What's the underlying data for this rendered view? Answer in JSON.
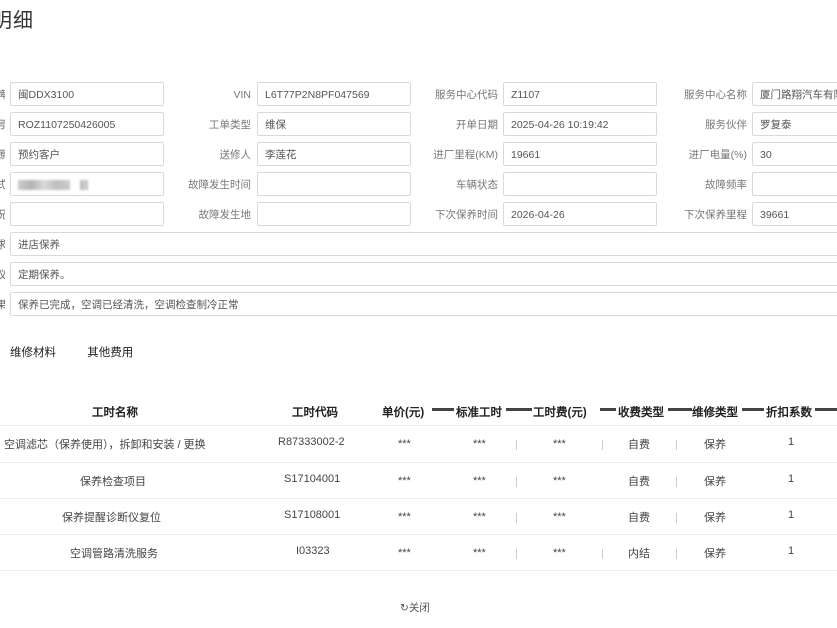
{
  "page": {
    "title": "明细"
  },
  "form": {
    "rows": [
      {
        "cut_label": "牌",
        "plate": "闽DDX3100",
        "vin_label": "VIN",
        "vin": "L6T77P2N8PF047569",
        "center_code_label": "服务中心代码",
        "center_code": "Z1107",
        "center_name_label": "服务中心名称",
        "center_name": "厦门路翔汽车有限"
      },
      {
        "cut_label": "号",
        "order_no": "ROZ1107250426005",
        "order_type_label": "工单类型",
        "order_type": "维保",
        "open_date_label": "开单日期",
        "open_date": "2025-04-26 10:19:42",
        "advisor_label": "服务伙伴",
        "advisor": "罗复泰"
      },
      {
        "cut_label": "源",
        "source": "预约客户",
        "sender_label": "送修人",
        "sender": "李莲花",
        "mileage_label": "进厂里程(KM)",
        "mileage": "19661",
        "battery_label": "进厂电量(%)",
        "battery": "30"
      },
      {
        "cut_label": "式",
        "contact": "",
        "fault_time_label": "故障发生时间",
        "fault_time": "",
        "status_label": "车辆状态",
        "status": "",
        "fault_freq_label": "故障频率",
        "fault_freq": ""
      },
      {
        "cut_label": "况",
        "condition": "",
        "fault_place_label": "故障发生地",
        "fault_place": "",
        "next_date_label": "下次保养时间",
        "next_date": "2026-04-26",
        "next_mileage_label": "下次保养里程",
        "next_mileage": "39661"
      }
    ],
    "wide_rows": [
      {
        "cut_label": "求",
        "value": "进店保养"
      },
      {
        "cut_label": "议",
        "value": "定期保养。"
      },
      {
        "cut_label": "果",
        "value": "保养已完成，空调已经清洗，空调检查制冷正常"
      }
    ]
  },
  "tabs": [
    "维修材料",
    "其他费用"
  ],
  "table": {
    "headers": [
      "工时名称",
      "工时代码",
      "单价(元)",
      "标准工时",
      "工时费(元)",
      "收费类型",
      "维修类型",
      "折扣系数"
    ],
    "rows": [
      {
        "name": "空调滤芯（保养使用），拆卸和安装 / 更换",
        "code": "R87333002-2",
        "price": "***",
        "hours": "***",
        "fee": "***",
        "charge": "自费",
        "repair": "保养",
        "discount": "1"
      },
      {
        "name": "保养检查项目",
        "code": "S17104001",
        "price": "***",
        "hours": "***",
        "fee": "***",
        "charge": "自费",
        "repair": "保养",
        "discount": "1"
      },
      {
        "name": "保养提醒诊断仪复位",
        "code": "S17108001",
        "price": "***",
        "hours": "***",
        "fee": "***",
        "charge": "自费",
        "repair": "保养",
        "discount": "1"
      },
      {
        "name": "空调管路清洗服务",
        "code": "I03323",
        "price": "***",
        "hours": "***",
        "fee": "***",
        "charge": "内结",
        "repair": "保养",
        "discount": "1"
      }
    ]
  },
  "footer": {
    "close_label": "关闭",
    "close_icon": "↻"
  }
}
